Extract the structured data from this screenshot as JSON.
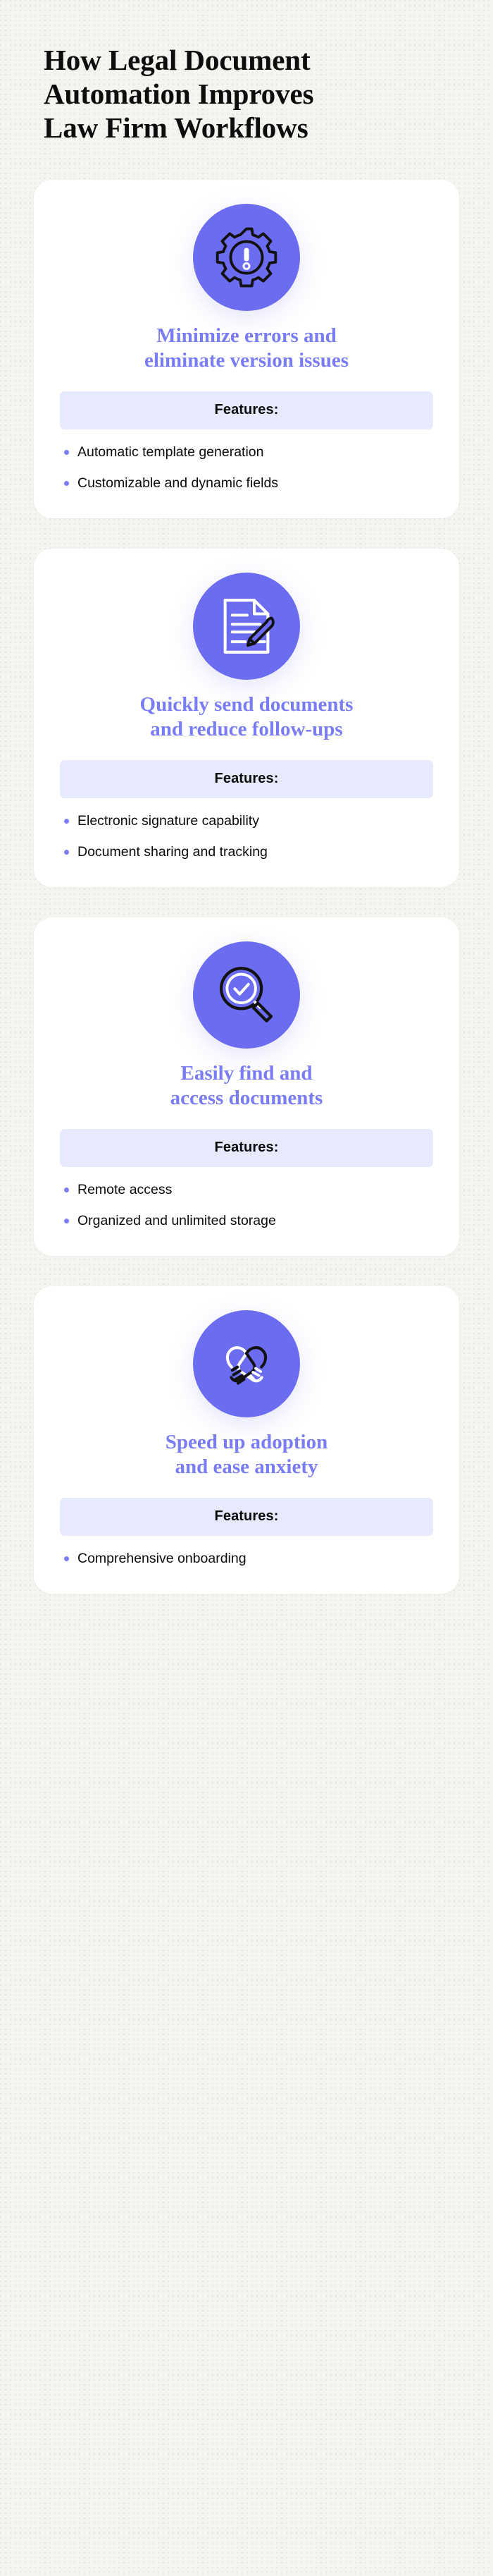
{
  "theme": {
    "page_background": "#f4f5f0",
    "card_background": "#ffffff",
    "accent_purple": "#6c6cf0",
    "heading_purple": "#7a7cf2",
    "features_bar_background": "#e7e9fc",
    "body_text": "#0b0b0b",
    "title_text": "#0d0d0d"
  },
  "title": {
    "full": "How Legal Document Automation Improves Law Firm Workflows",
    "lines": [
      "How Legal Document",
      "Automation Improves",
      "Law Firm Workflows"
    ]
  },
  "features_label": "Features:",
  "cards": [
    {
      "icon": "gear-exclamation-icon",
      "heading": "Minimize errors and eliminate version issues",
      "heading_lines": [
        "Minimize errors and",
        "eliminate version issues"
      ],
      "features_label": "Features:",
      "features": [
        "Automatic template generation",
        "Customizable and dynamic fields"
      ]
    },
    {
      "icon": "document-pencil-icon",
      "heading": "Quickly send documents and reduce follow-ups",
      "heading_lines": [
        "Quickly send documents",
        "and reduce follow-ups"
      ],
      "features_label": "Features:",
      "features": [
        "Electronic signature capability",
        "Document sharing and tracking"
      ]
    },
    {
      "icon": "magnifier-check-icon",
      "heading": "Easily find and access documents",
      "heading_lines": [
        "Easily find and",
        "access documents"
      ],
      "features_label": "Features:",
      "features": [
        "Remote access",
        "Organized and unlimited storage"
      ]
    },
    {
      "icon": "handshake-heart-icon",
      "heading": "Speed up adoption and ease anxiety",
      "heading_lines": [
        "Speed up adoption",
        "and ease anxiety"
      ],
      "features_label": "Features:",
      "features": [
        "Comprehensive onboarding"
      ]
    }
  ]
}
